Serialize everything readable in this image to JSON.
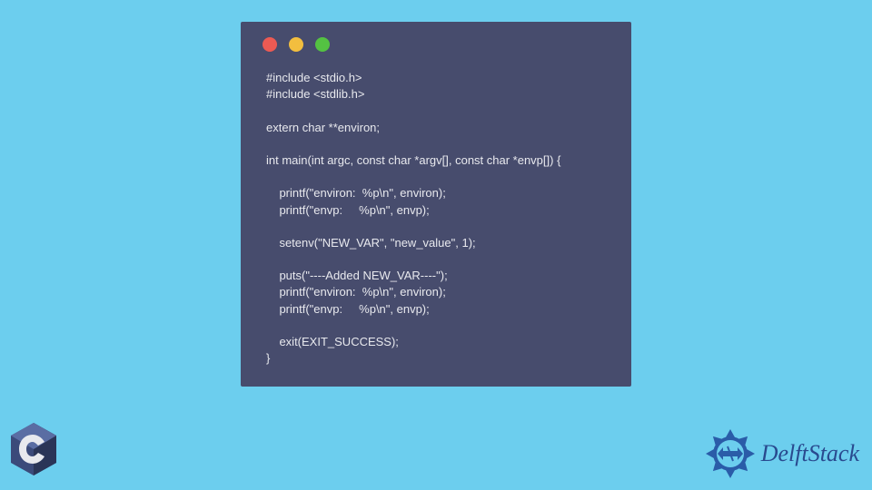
{
  "code": {
    "lines": "#include <stdio.h>\n#include <stdlib.h>\n\nextern char **environ;\n\nint main(int argc, const char *argv[], const char *envp[]) {\n\n    printf(\"environ:  %p\\n\", environ);\n    printf(\"envp:     %p\\n\", envp);\n\n    setenv(\"NEW_VAR\", \"new_value\", 1);\n\n    puts(\"----Added NEW_VAR----\");\n    printf(\"environ:  %p\\n\", environ);\n    printf(\"envp:     %p\\n\", envp);\n\n    exit(EXIT_SUCCESS);\n}"
  },
  "brand": {
    "name": "DelftStack"
  }
}
